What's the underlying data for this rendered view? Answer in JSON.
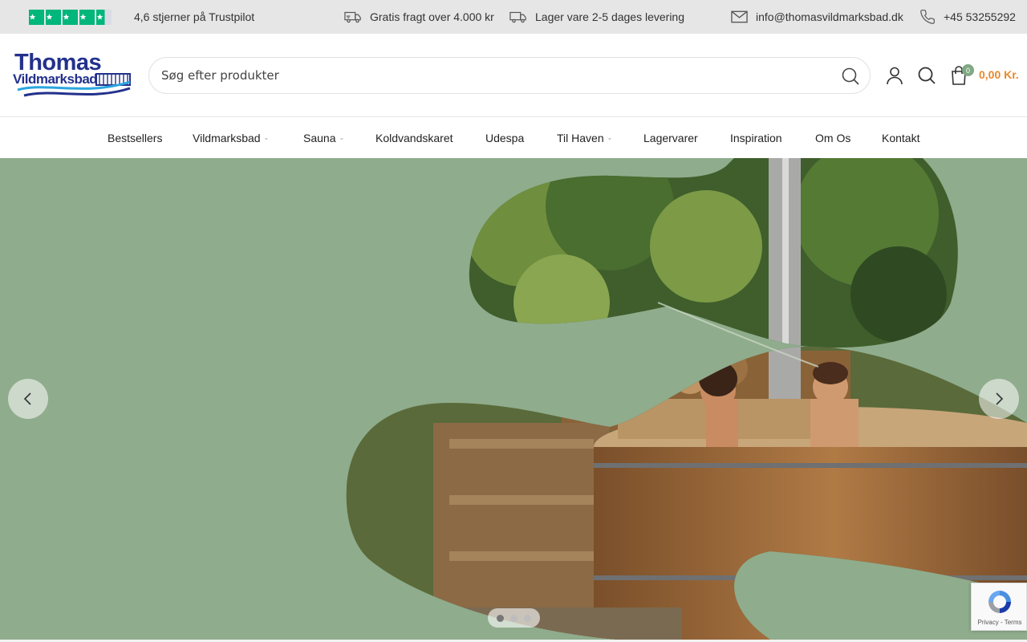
{
  "topbar": {
    "trustpilot_text": "4,6 stjerner på Trustpilot",
    "shipping_text": "Gratis fragt over 4.000 kr",
    "stock_text": "Lager vare 2-5 dages levering",
    "email_text": "info@thomasvildmarksbad.dk",
    "phone_text": "+45 53255292"
  },
  "logo": {
    "line1": "Thomas",
    "line2": "Vildmarksbad"
  },
  "search": {
    "placeholder": "Søg efter produkter"
  },
  "cart": {
    "count": "0",
    "total": "0,00 Kr."
  },
  "nav": {
    "items": [
      {
        "label": "Bestsellers"
      },
      {
        "label": "Vildmarksbad"
      },
      {
        "label": "Sauna"
      },
      {
        "label": "Koldvandskaret"
      },
      {
        "label": "Udespa"
      },
      {
        "label": "Til Haven"
      },
      {
        "label": "Lagervarer"
      },
      {
        "label": "Inspiration"
      },
      {
        "label": "Om Os"
      },
      {
        "label": "Kontakt"
      }
    ]
  },
  "hero": {
    "slide_count": 3,
    "active_slide": 1
  },
  "recaptcha": {
    "links": "Privacy - Terms"
  },
  "colors": {
    "hero_bg": "#8fac8c",
    "brand_blue": "#23318c",
    "accent_orange": "#e8892d",
    "trustpilot_green": "#00b67a"
  }
}
